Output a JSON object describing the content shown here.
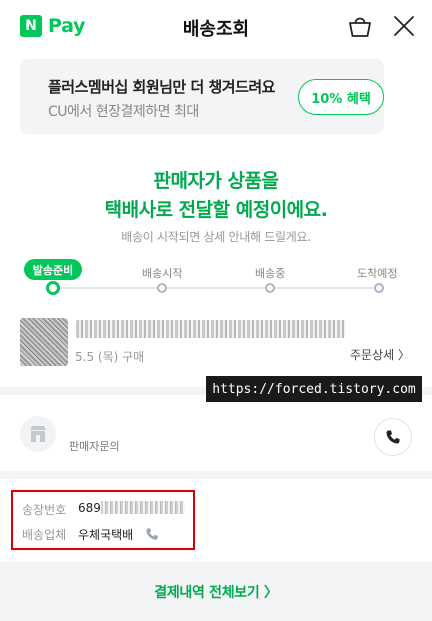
{
  "header": {
    "logo_mark": "N",
    "logo_text": "Pay",
    "title": "배송조회"
  },
  "promo": {
    "title": "플러스멤버십 회원님만 더 챙겨드려요",
    "subtitle": "CU에서 현장결제하면 최대",
    "button_label": "10% 혜택"
  },
  "status": {
    "line1": "판매자가 상품을",
    "line2": "택배사로 전달할 예정이에요.",
    "sub": "배송이 시작되면 상세 안내해 드릴게요."
  },
  "progress": {
    "steps": [
      "발송준비",
      "배송시작",
      "배송중",
      "도착예정"
    ],
    "current_step": 1
  },
  "product": {
    "date": "5.5 (목) 구매",
    "order_detail_label": "주문상세 〉"
  },
  "watermark": "https://forced.tistory.com",
  "seller": {
    "label": "판매자문의"
  },
  "delivery": {
    "tracking_label": "송장번호",
    "tracking_prefix": "689",
    "carrier_label": "배송업체",
    "carrier_value": "우체국택배"
  },
  "footer": {
    "link_label": "결제내역 전체보기 〉"
  },
  "colors": {
    "brand": "#03c75a",
    "highlight_box": "#e00000"
  }
}
